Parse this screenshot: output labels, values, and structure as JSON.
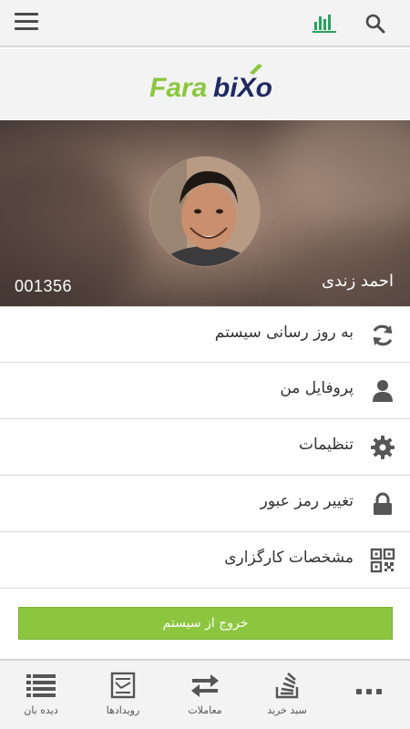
{
  "header": {
    "menu_icon": "hamburger-menu-icon",
    "chart_icon": "bar-chart-icon",
    "search_icon": "search-icon",
    "chart_icon_color": "#2aa15f"
  },
  "brand": {
    "logo_part1": "Fara",
    "logo_part2": "biXo",
    "logo_green": "#8cc63f",
    "logo_navy": "#1f2a63"
  },
  "profile": {
    "name": "احمد زندی",
    "user_id": "001356"
  },
  "menu": {
    "items": [
      {
        "label": "به روز رسانی سیستم",
        "icon": "refresh-icon"
      },
      {
        "label": "پروفایل من",
        "icon": "user-icon"
      },
      {
        "label": "تنظیمات",
        "icon": "gear-icon"
      },
      {
        "label": "تغییر رمز عبور",
        "icon": "lock-icon"
      },
      {
        "label": "مشخصات کارگزاری",
        "icon": "qr-code-icon"
      }
    ]
  },
  "logout": {
    "label": "خروج از سیستم",
    "color": "#8cc63f"
  },
  "bottom_nav": {
    "items": [
      {
        "label": "دیده بان",
        "icon": "watchlist-icon"
      },
      {
        "label": "رویدادها",
        "icon": "events-icon"
      },
      {
        "label": "معاملات",
        "icon": "transfer-arrows-icon"
      },
      {
        "label": "سبد خرید",
        "icon": "cart-stack-icon"
      },
      {
        "label": "",
        "icon": "more-dots-icon"
      }
    ]
  }
}
